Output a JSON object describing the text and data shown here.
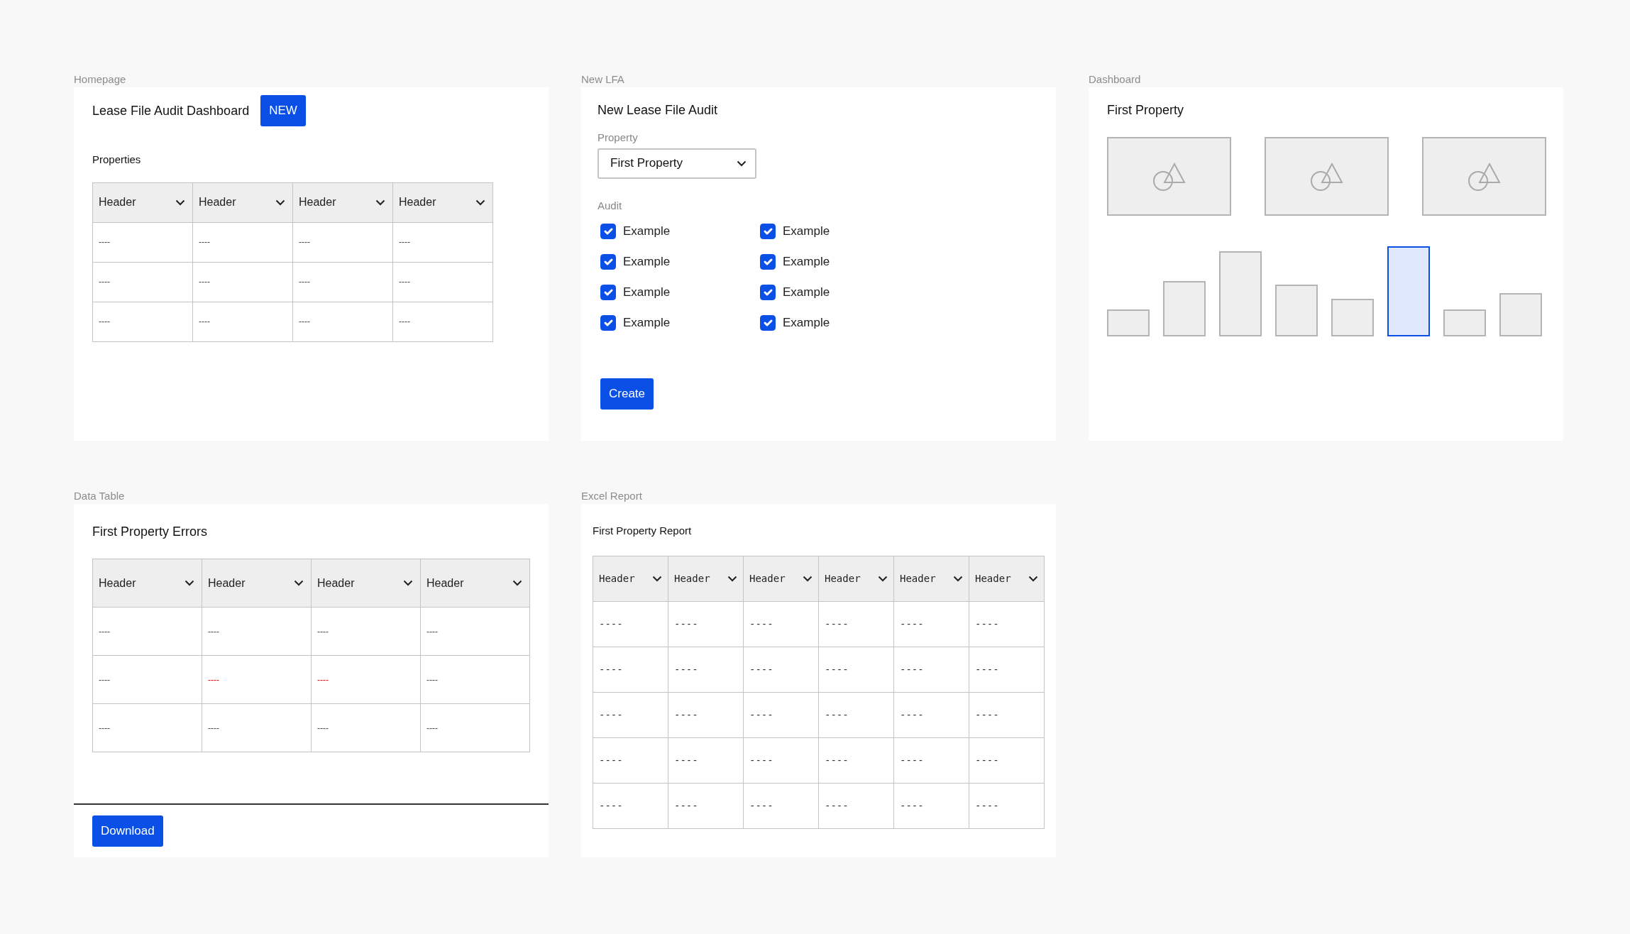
{
  "homepage": {
    "frame_label": "Homepage",
    "title": "Lease File Audit Dashboard",
    "new_button": "NEW",
    "table_title": "Properties",
    "table": {
      "columns": [
        "Header",
        "Header",
        "Header",
        "Header"
      ],
      "rows": [
        [
          "----",
          "----",
          "----",
          "----"
        ],
        [
          "----",
          "----",
          "----",
          "----"
        ],
        [
          "----",
          "----",
          "----",
          "----"
        ]
      ]
    }
  },
  "new_lfa": {
    "frame_label": "New LFA",
    "title": "New Lease File Audit",
    "property_label": "Property",
    "property_value": "First Property",
    "audit_label": "Audit",
    "checkboxes": [
      {
        "label": "Example",
        "checked": true
      },
      {
        "label": "Example",
        "checked": true
      },
      {
        "label": "Example",
        "checked": true
      },
      {
        "label": "Example",
        "checked": true
      },
      {
        "label": "Example",
        "checked": true
      },
      {
        "label": "Example",
        "checked": true
      },
      {
        "label": "Example",
        "checked": true
      },
      {
        "label": "Example",
        "checked": true
      }
    ],
    "create_button": "Create"
  },
  "dashboard": {
    "frame_label": "Dashboard",
    "title": "First Property",
    "bars": [
      {
        "selected": false
      },
      {
        "selected": false
      },
      {
        "selected": false
      },
      {
        "selected": false
      },
      {
        "selected": false
      },
      {
        "selected": true
      },
      {
        "selected": false
      },
      {
        "selected": false
      }
    ]
  },
  "data_table": {
    "frame_label": "Data Table",
    "title": "First Property Errors",
    "table": {
      "columns": [
        "Header",
        "Header",
        "Header",
        "Header"
      ],
      "rows": [
        [
          {
            "text": "----",
            "error": false
          },
          {
            "text": "----",
            "error": false
          },
          {
            "text": "----",
            "error": false
          },
          {
            "text": "----",
            "error": false
          }
        ],
        [
          {
            "text": "----",
            "error": false
          },
          {
            "text": "----",
            "error": true
          },
          {
            "text": "----",
            "error": true
          },
          {
            "text": "----",
            "error": false
          }
        ],
        [
          {
            "text": "----",
            "error": false
          },
          {
            "text": "----",
            "error": false
          },
          {
            "text": "----",
            "error": false
          },
          {
            "text": "----",
            "error": false
          }
        ]
      ]
    },
    "download_button": "Download"
  },
  "excel_report": {
    "frame_label": "Excel Report",
    "title": "First Property Report",
    "table": {
      "columns": [
        "Header",
        "Header",
        "Header",
        "Header",
        "Header",
        "Header"
      ],
      "rows": [
        [
          "----",
          "----",
          "----",
          "----",
          "----",
          "----"
        ],
        [
          "----",
          "----",
          "----",
          "----",
          "----",
          "----"
        ],
        [
          "----",
          "----",
          "----",
          "----",
          "----",
          "----"
        ],
        [
          "----",
          "----",
          "----",
          "----",
          "----",
          "----"
        ],
        [
          "----",
          "----",
          "----",
          "----",
          "----",
          "----"
        ]
      ]
    }
  }
}
